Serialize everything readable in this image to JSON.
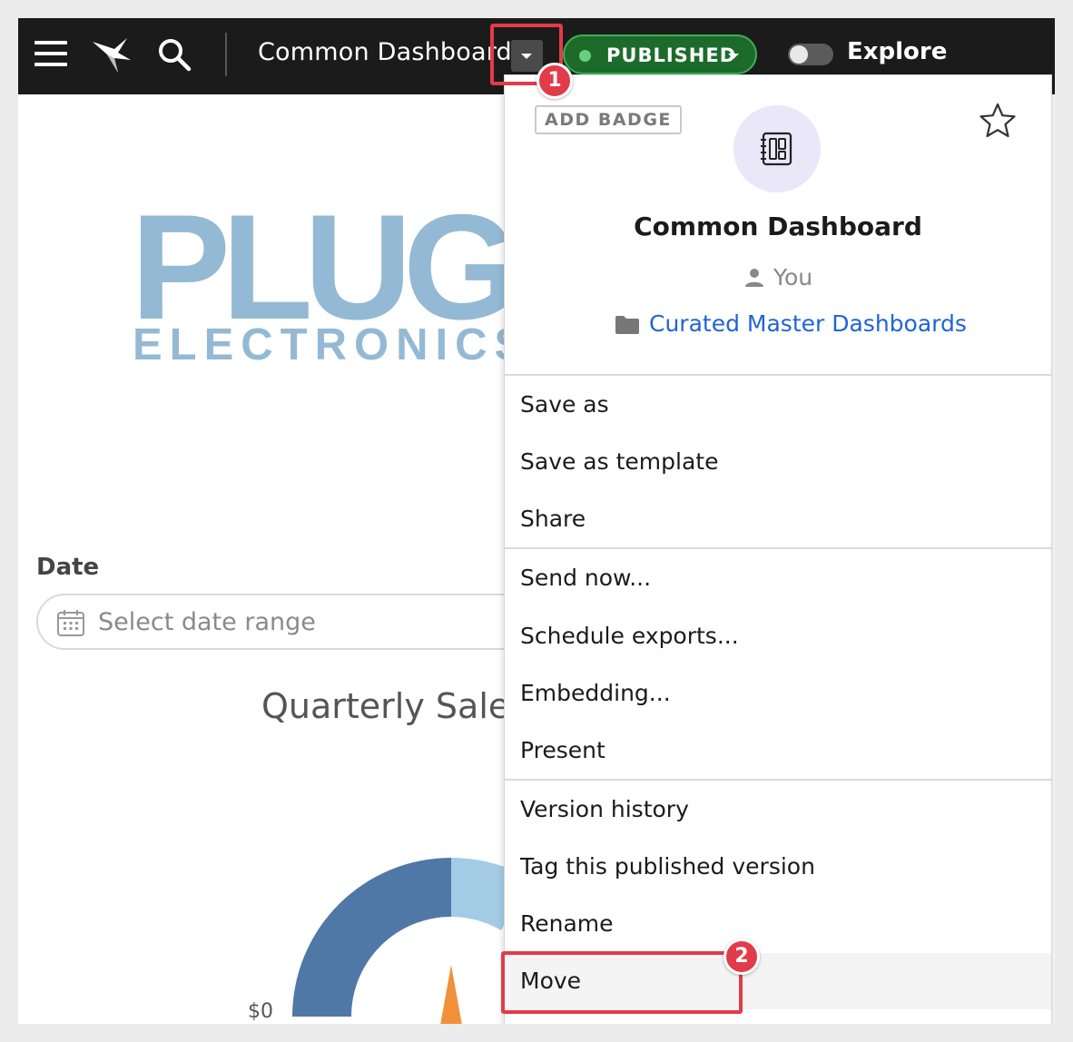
{
  "topbar": {
    "document_title": "Common Dashboard",
    "status_label": "PUBLISHED",
    "explore_label": "Explore",
    "icons": [
      "menu-icon",
      "app-logo-icon",
      "search-icon",
      "chevron-down-icon"
    ]
  },
  "dashboard": {
    "logo_main": "PLUGS",
    "logo_sub": "ELECTRONICS",
    "date_filter_label": "Date",
    "date_filter_placeholder": "Select date range",
    "chart_title": "Quarterly Sales",
    "axis_label_zero": "$0",
    "gauge_colors": [
      "#4f78a6",
      "#a4cbe6",
      "#f0913a"
    ]
  },
  "menu": {
    "add_badge_label": "ADD BADGE",
    "document_title": "Common Dashboard",
    "owner": "You",
    "folder": "Curated Master Dashboards",
    "groups": [
      [
        "Save as",
        "Save as template",
        "Share"
      ],
      [
        "Send now...",
        "Schedule exports...",
        "Embedding...",
        "Present"
      ],
      [
        "Version history",
        "Tag this published version",
        "Rename",
        "Move"
      ]
    ]
  },
  "annotations": {
    "step1": "1",
    "step2": "2",
    "highlight_color": "#e23b4a"
  }
}
